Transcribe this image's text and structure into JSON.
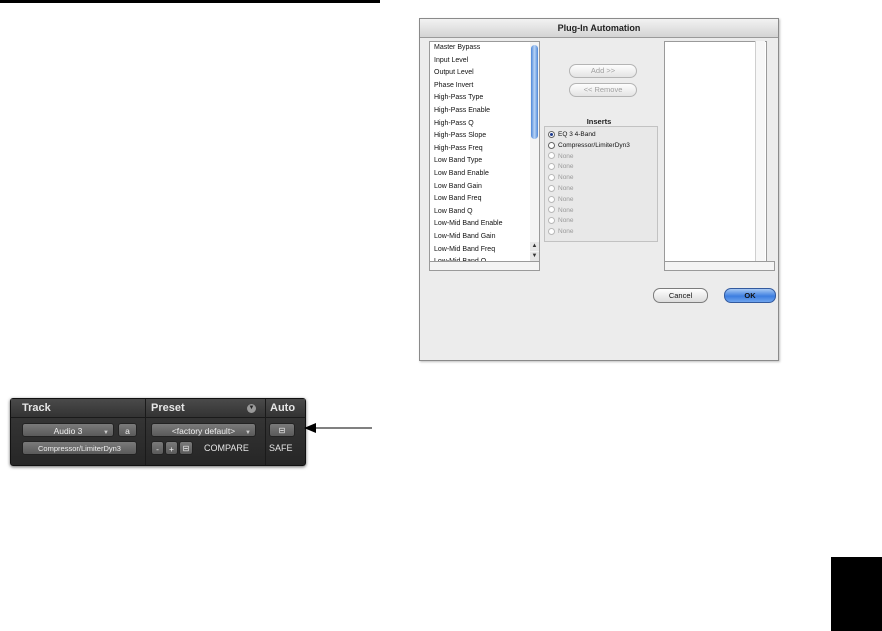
{
  "dialog": {
    "title": "Plug-In Automation",
    "parameters": [
      "Master Bypass",
      "Input Level",
      "Output Level",
      "Phase Invert",
      "High-Pass Type",
      "High-Pass Enable",
      "High-Pass Q",
      "High-Pass Slope",
      "High-Pass Freq",
      "Low Band Type",
      "Low Band Enable",
      "Low Band Gain",
      "Low Band Freq",
      "Low Band Q",
      "Low-Mid Band Enable",
      "Low-Mid Band Gain",
      "Low-Mid Band Freq",
      "Low-Mid Band Q"
    ],
    "add_label": "Add >>",
    "remove_label": "<< Remove",
    "inserts_label": "Inserts",
    "inserts": [
      {
        "label": "EQ 3 4-Band",
        "selected": true,
        "enabled": true
      },
      {
        "label": "Compressor/LimiterDyn3",
        "selected": false,
        "enabled": true
      },
      {
        "label": "None",
        "selected": false,
        "enabled": false
      },
      {
        "label": "None",
        "selected": false,
        "enabled": false
      },
      {
        "label": "None",
        "selected": false,
        "enabled": false
      },
      {
        "label": "None",
        "selected": false,
        "enabled": false
      },
      {
        "label": "None",
        "selected": false,
        "enabled": false
      },
      {
        "label": "None",
        "selected": false,
        "enabled": false
      },
      {
        "label": "None",
        "selected": false,
        "enabled": false
      },
      {
        "label": "None",
        "selected": false,
        "enabled": false
      }
    ],
    "cancel_label": "Cancel",
    "ok_label": "OK"
  },
  "plugin_header": {
    "track_label": "Track",
    "preset_label": "Preset",
    "auto_label": "Auto",
    "track_name": "Audio 3",
    "group_button": "a",
    "insert_name": "Compressor/LimiterDyn3",
    "preset_name": "<factory default>",
    "minus_label": "-",
    "plus_label": "+",
    "compare_label": "COMPARE",
    "safe_label": "SAFE"
  },
  "icons": {
    "auto_icon": "plugin-automation-icon",
    "copy_icon": "settings-clipboard-icon",
    "preset_menu_icon": "chevron-down-icon",
    "pointer": "arrow-left-icon"
  }
}
